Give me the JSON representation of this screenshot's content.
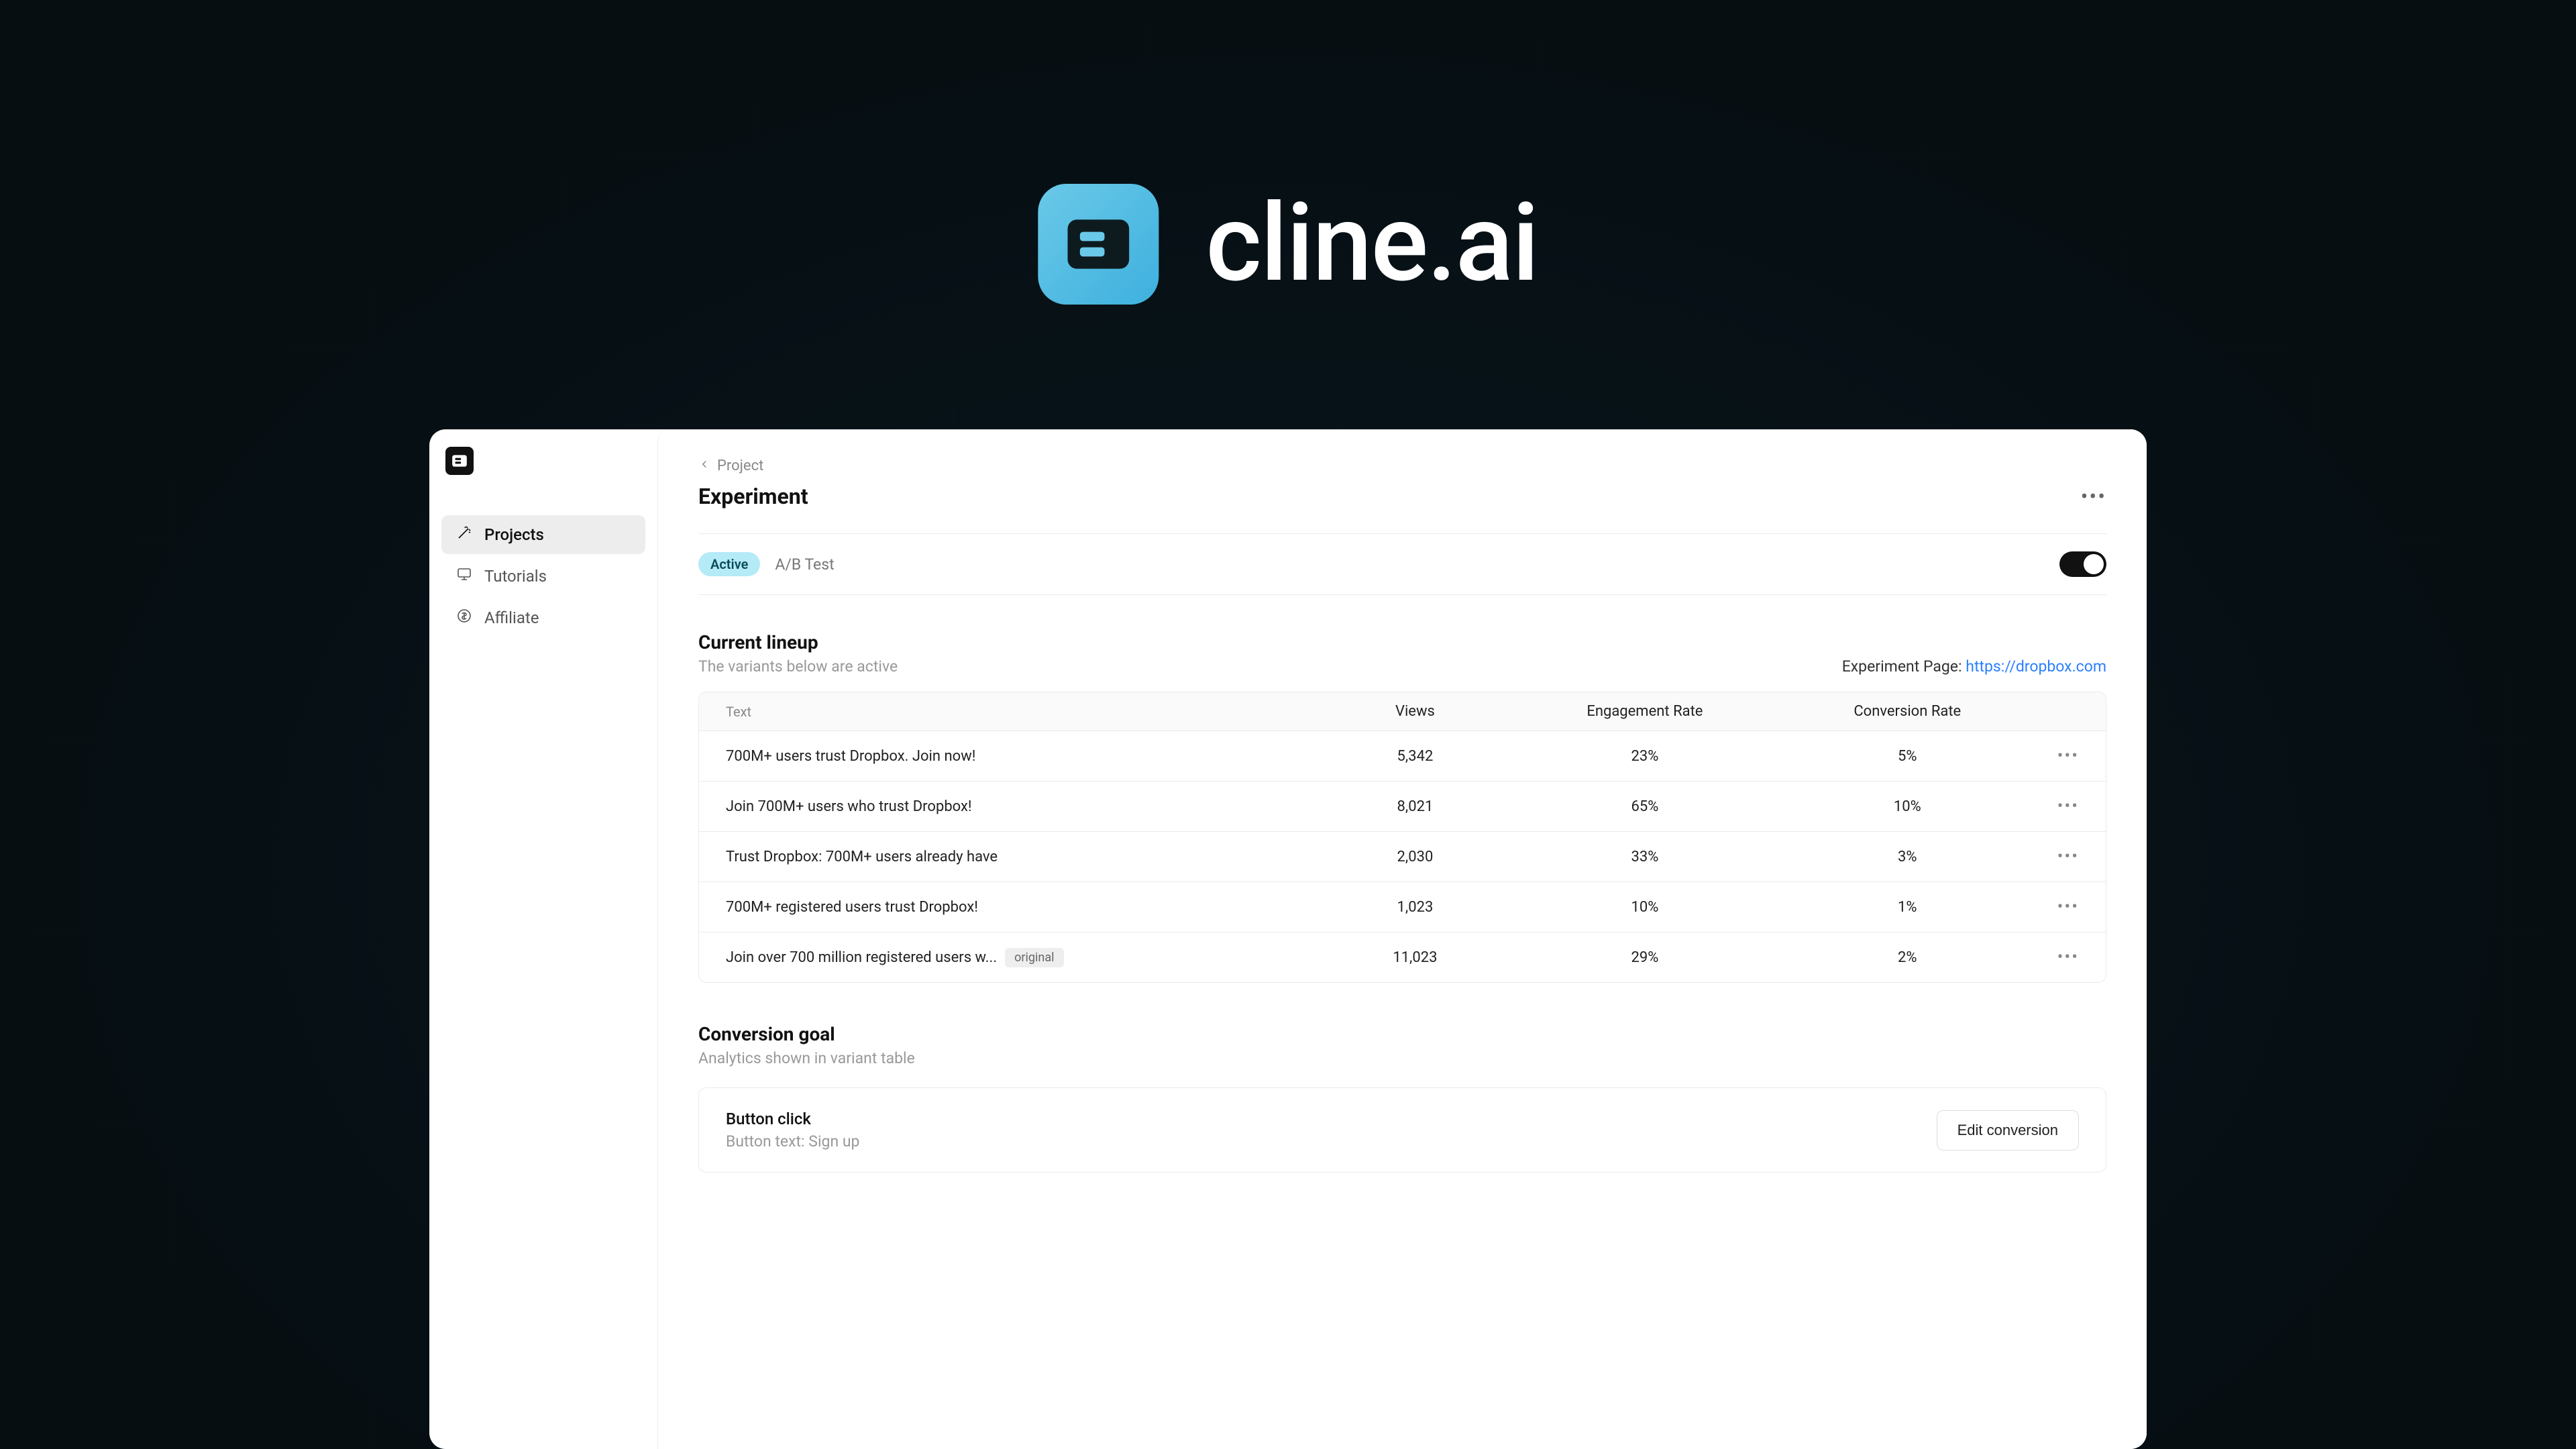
{
  "brand": {
    "title": "cline.ai"
  },
  "sidebar": {
    "items": [
      {
        "label": "Projects"
      },
      {
        "label": "Tutorials"
      },
      {
        "label": "Affiliate"
      }
    ]
  },
  "breadcrumb": {
    "label": "Project"
  },
  "page": {
    "title": "Experiment"
  },
  "status": {
    "badge": "Active",
    "type": "A/B Test"
  },
  "lineup": {
    "title": "Current lineup",
    "subtitle": "The variants below are active",
    "page_label": "Experiment Page:",
    "page_url": "https://dropbox.com",
    "columns": {
      "text": "Text",
      "views": "Views",
      "engagement": "Engagement Rate",
      "conversion": "Conversion Rate"
    },
    "rows": [
      {
        "text": "700M+ users trust Dropbox. Join now!",
        "views": "5,342",
        "engagement": "23%",
        "conversion": "5%",
        "original": false
      },
      {
        "text": "Join 700M+ users who trust Dropbox!",
        "views": "8,021",
        "engagement": "65%",
        "conversion": "10%",
        "original": false
      },
      {
        "text": "Trust Dropbox: 700M+ users already have",
        "views": "2,030",
        "engagement": "33%",
        "conversion": "3%",
        "original": false
      },
      {
        "text": "700M+ registered users trust Dropbox!",
        "views": "1,023",
        "engagement": "10%",
        "conversion": "1%",
        "original": false
      },
      {
        "text": "Join over 700 million registered users w...",
        "views": "11,023",
        "engagement": "29%",
        "conversion": "2%",
        "original": true,
        "original_label": "original"
      }
    ]
  },
  "goal": {
    "title": "Conversion goal",
    "subtitle": "Analytics shown in variant table",
    "card_title": "Button click",
    "card_sub": "Button text: Sign up",
    "edit_label": "Edit conversion"
  }
}
